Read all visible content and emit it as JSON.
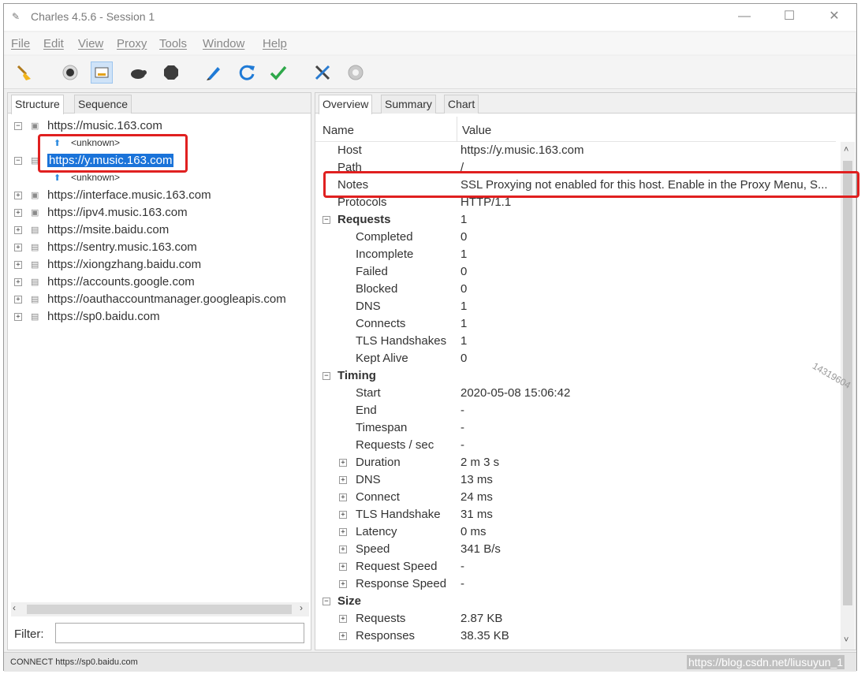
{
  "window": {
    "title": "Charles 4.5.6 - Session 1",
    "min_glyph": "—",
    "max_glyph": "☐",
    "close_glyph": "✕"
  },
  "menu": [
    "File",
    "Edit",
    "View",
    "Proxy",
    "Tools",
    "Window",
    "Help"
  ],
  "toolbar": {
    "icons": [
      "broom-icon",
      "record-icon",
      "throttle-icon",
      "turtle-icon",
      "breakpoint-icon",
      "pen-icon",
      "refresh-icon",
      "check-icon",
      "tools-icon",
      "settings-icon"
    ],
    "colors": {
      "accent": "#1a73d9",
      "highlight": "#e02020",
      "check": "#2ea84a",
      "refresh": "#1f7ad6"
    }
  },
  "left": {
    "tabs": [
      "Structure",
      "Sequence"
    ],
    "hosts": [
      {
        "label": "https://music.163.com",
        "expander": "−",
        "child": "<unknown>"
      },
      {
        "label": "https://y.music.163.com",
        "expander": "−",
        "child": "<unknown>",
        "selected": true
      },
      {
        "label": "https://interface.music.163.com",
        "expander": "+"
      },
      {
        "label": "https://ipv4.music.163.com",
        "expander": "+"
      },
      {
        "label": "https://msite.baidu.com",
        "expander": "+"
      },
      {
        "label": "https://sentry.music.163.com",
        "expander": "+"
      },
      {
        "label": "https://xiongzhang.baidu.com",
        "expander": "+"
      },
      {
        "label": "https://accounts.google.com",
        "expander": "+"
      },
      {
        "label": "https://oauthaccountmanager.googleapis.com",
        "expander": "+"
      },
      {
        "label": "https://sp0.baidu.com",
        "expander": "+"
      }
    ],
    "filter_label": "Filter:",
    "filter_value": ""
  },
  "right": {
    "tabs": [
      "Overview",
      "Summary",
      "Chart"
    ],
    "columns": {
      "name": "Name",
      "value": "Value"
    },
    "rows": [
      {
        "name": "Host",
        "value": "https://y.music.163.com",
        "level": 1
      },
      {
        "name": "Path",
        "value": "/",
        "level": 1
      },
      {
        "name": "Notes",
        "value": "SSL Proxying not enabled for this host. Enable in the Proxy Menu, S...",
        "level": 1
      },
      {
        "name": "Protocols",
        "value": "HTTP/1.1",
        "level": 1
      },
      {
        "name": "Requests",
        "value": "1",
        "level": 0,
        "section": true
      },
      {
        "name": "Completed",
        "value": "0",
        "level": 2
      },
      {
        "name": "Incomplete",
        "value": "1",
        "level": 2
      },
      {
        "name": "Failed",
        "value": "0",
        "level": 2
      },
      {
        "name": "Blocked",
        "value": "0",
        "level": 2
      },
      {
        "name": "DNS",
        "value": "1",
        "level": 2
      },
      {
        "name": "Connects",
        "value": "1",
        "level": 2
      },
      {
        "name": "TLS Handshakes",
        "value": "1",
        "level": 2
      },
      {
        "name": "Kept Alive",
        "value": "0",
        "level": 2
      },
      {
        "name": "Timing",
        "value": "",
        "level": 0,
        "section": true
      },
      {
        "name": "Start",
        "value": "2020-05-08 15:06:42",
        "level": 2
      },
      {
        "name": "End",
        "value": "-",
        "level": 2
      },
      {
        "name": "Timespan",
        "value": "-",
        "level": 2
      },
      {
        "name": "Requests / sec",
        "value": "-",
        "level": 2
      },
      {
        "name": "Duration",
        "value": "2 m 3 s",
        "level": 2,
        "expand": true
      },
      {
        "name": "DNS",
        "value": "13 ms",
        "level": 2,
        "expand": true
      },
      {
        "name": "Connect",
        "value": "24 ms",
        "level": 2,
        "expand": true
      },
      {
        "name": "TLS Handshake",
        "value": "31 ms",
        "level": 2,
        "expand": true
      },
      {
        "name": "Latency",
        "value": "0 ms",
        "level": 2,
        "expand": true
      },
      {
        "name": "Speed",
        "value": "341 B/s",
        "level": 2,
        "expand": true
      },
      {
        "name": "Request Speed",
        "value": "-",
        "level": 2,
        "expand": true
      },
      {
        "name": "Response Speed",
        "value": "-",
        "level": 2,
        "expand": true
      },
      {
        "name": "Size",
        "value": "",
        "level": 0,
        "section": true
      },
      {
        "name": "Requests",
        "value": "2.87 KB",
        "level": 2,
        "expand": true
      },
      {
        "name": "Responses",
        "value": "38.35 KB",
        "level": 2,
        "expand": true
      }
    ]
  },
  "status": {
    "text": "CONNECT https://sp0.baidu.com",
    "watermark": "https://blog.csdn.net/liusuyun_1",
    "side_mark": "14319604"
  }
}
